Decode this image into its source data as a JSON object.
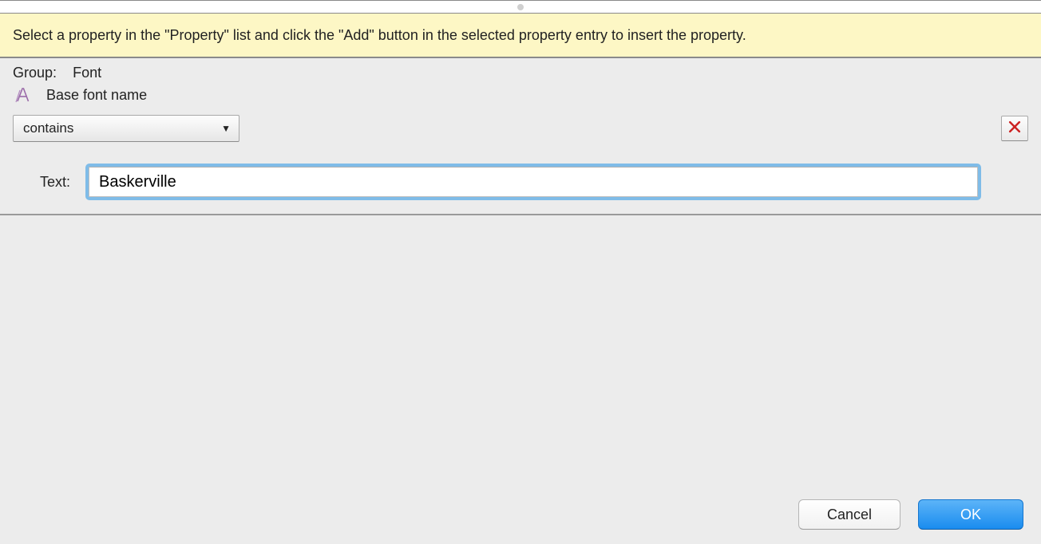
{
  "banner": {
    "text": "Select a property in the \"Property\" list and click the \"Add\" button in the selected property entry to insert the property."
  },
  "group": {
    "label": "Group:",
    "value": "Font"
  },
  "property": {
    "name": "Base font name"
  },
  "condition": {
    "selected": "contains"
  },
  "textField": {
    "label": "Text:",
    "value": "Baskerville"
  },
  "buttons": {
    "cancel": "Cancel",
    "ok": "OK"
  }
}
